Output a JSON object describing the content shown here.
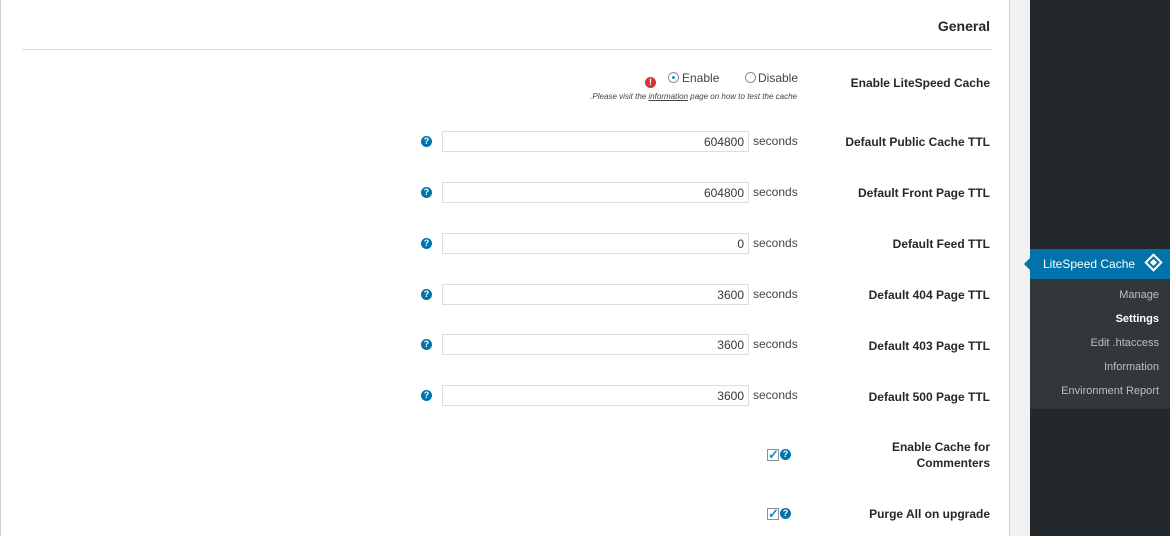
{
  "section": {
    "title": "General"
  },
  "enable_cache": {
    "label": "Enable LiteSpeed Cache",
    "options": [
      "Enable",
      "Disable"
    ],
    "selected": "Enable",
    "note_prefix": ".Please visit the ",
    "note_link": "information",
    "note_suffix": " page on how to test the cache"
  },
  "ttl_rows": [
    {
      "label": "Default Public Cache TTL",
      "value": "604800",
      "unit": "seconds"
    },
    {
      "label": "Default Front Page TTL",
      "value": "604800",
      "unit": "seconds"
    },
    {
      "label": "Default Feed TTL",
      "value": "0",
      "unit": "seconds"
    },
    {
      "label": "Default 404 Page TTL",
      "value": "3600",
      "unit": "seconds"
    },
    {
      "label": "Default 403 Page TTL",
      "value": "3600",
      "unit": "seconds"
    },
    {
      "label": "Default 500 Page TTL",
      "value": "3600",
      "unit": "seconds"
    }
  ],
  "checkboxes": [
    {
      "label_line1": "Enable Cache for",
      "label_line2": "Commenters",
      "checked": true
    },
    {
      "label": "Purge All on upgrade",
      "checked": true
    }
  ],
  "sidebar": {
    "menu_title": "LiteSpeed Cache",
    "items": [
      {
        "label": "Manage",
        "current": false
      },
      {
        "label": "Settings",
        "current": true
      },
      {
        "label": "Edit .htaccess",
        "current": false
      },
      {
        "label": "Information",
        "current": false
      },
      {
        "label": "Environment Report",
        "current": false
      }
    ]
  },
  "colors": {
    "accent": "#0073aa",
    "sidebar_bg": "#23282d",
    "warning": "#dc3232"
  }
}
